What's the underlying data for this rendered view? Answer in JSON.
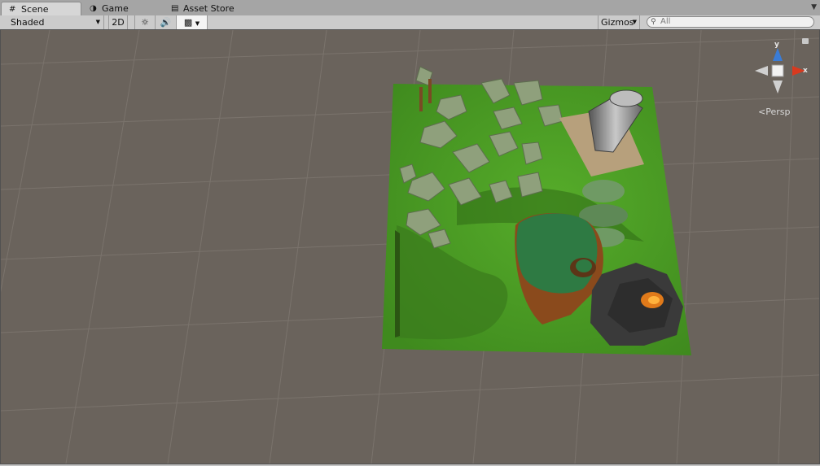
{
  "tabs": [
    {
      "label": "Scene",
      "icon": "grid-icon",
      "active": true
    },
    {
      "label": "Game",
      "icon": "pacman-icon",
      "active": false
    },
    {
      "label": "Asset Store",
      "icon": "bag-icon",
      "active": false
    }
  ],
  "toolbar": {
    "shading_mode": "Shaded",
    "mode_2d_label": "2D",
    "gizmos_label": "Gizmos",
    "search_placeholder": "All"
  },
  "viewport": {
    "projection_label": "Persp",
    "axes": {
      "y": "y",
      "x": "x"
    },
    "colors": {
      "background": "#6a635c",
      "ground": "#4fa224",
      "x_axis": "#d83a1f",
      "y_axis": "#3a7cd6"
    }
  }
}
